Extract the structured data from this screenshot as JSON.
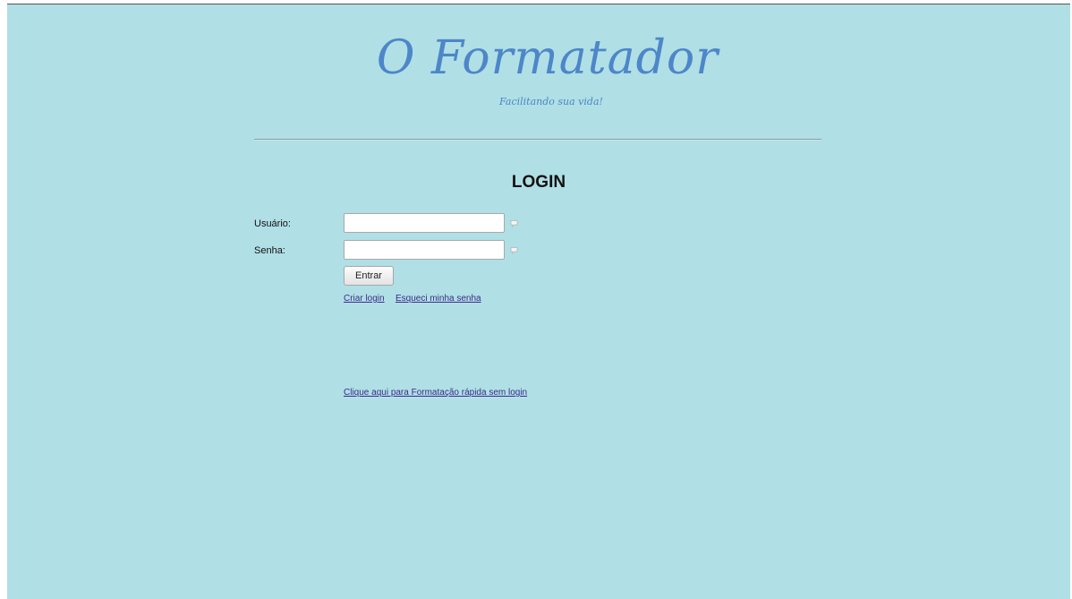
{
  "header": {
    "logo_title": "O Formatador",
    "logo_tagline": "Facilitando sua vida!"
  },
  "login": {
    "heading": "LOGIN",
    "username_label": "Usuário:",
    "username_value": "",
    "password_label": "Senha:",
    "password_value": "",
    "submit_label": "Entrar",
    "create_login_link": "Criar login",
    "forgot_password_link": "Esqueci minha senha"
  },
  "quick_format": {
    "link": "Clique aqui para Formatação rápida sem login"
  },
  "icons": {
    "username_hint": "speech-bubble-icon",
    "password_hint": "speech-bubble-icon"
  },
  "colors": {
    "background": "#b0dfe5",
    "logo": "#4d86c9",
    "link": "#3c2a8c"
  }
}
